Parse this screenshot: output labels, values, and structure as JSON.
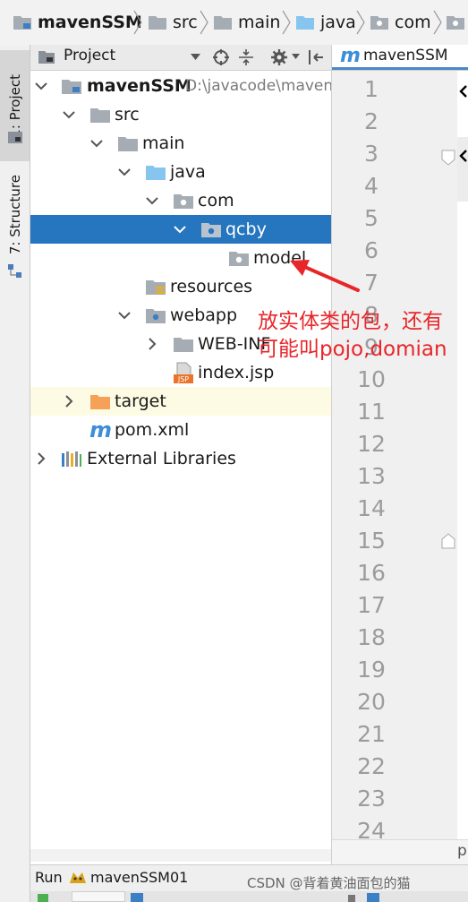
{
  "breadcrumb": {
    "items": [
      {
        "label": "mavenSSM",
        "icon": "module-folder-icon",
        "bold": true
      },
      {
        "label": "src",
        "icon": "folder-icon"
      },
      {
        "label": "main",
        "icon": "folder-icon"
      },
      {
        "label": "java",
        "icon": "source-folder-icon"
      },
      {
        "label": "com",
        "icon": "package-icon"
      }
    ]
  },
  "tool_window_strip": {
    "tabs": [
      {
        "label": "1: Project",
        "active": true
      },
      {
        "label": "7: Structure",
        "active": false
      }
    ]
  },
  "project_panel": {
    "view_selector": "Project",
    "tree": [
      {
        "label": "mavenSSM",
        "path_hint": "D:\\javacode\\maven",
        "icon": "module-folder-icon",
        "expanded": true,
        "bold": true
      },
      {
        "label": "src",
        "icon": "folder-icon",
        "expanded": true
      },
      {
        "label": "main",
        "icon": "folder-icon",
        "expanded": true
      },
      {
        "label": "java",
        "icon": "source-folder-icon",
        "expanded": true
      },
      {
        "label": "com",
        "icon": "package-icon",
        "expanded": true
      },
      {
        "label": "qcby",
        "icon": "package-icon",
        "expanded": true,
        "selected": true
      },
      {
        "label": "model",
        "icon": "package-icon"
      },
      {
        "label": "resources",
        "icon": "resources-folder-icon"
      },
      {
        "label": "webapp",
        "icon": "web-folder-icon",
        "expanded": true
      },
      {
        "label": "WEB-INF",
        "icon": "folder-icon",
        "expanded": false
      },
      {
        "label": "index.jsp",
        "icon": "jsp-file-icon"
      },
      {
        "label": "target",
        "icon": "excluded-folder-icon",
        "expanded": false,
        "highlighted": true
      },
      {
        "label": "pom.xml",
        "icon": "maven-file-icon"
      },
      {
        "label": "External Libraries",
        "icon": "libraries-icon",
        "expanded": false
      }
    ]
  },
  "editor": {
    "tab_label": "mavenSSM",
    "line_numbers": [
      "1",
      "2",
      "3",
      "4",
      "5",
      "6",
      "7",
      "8",
      "9",
      "10",
      "11",
      "12",
      "13",
      "14",
      "15",
      "16",
      "17",
      "18",
      "19",
      "20",
      "21",
      "22",
      "23",
      "24"
    ]
  },
  "annotation": {
    "line1": "放实体类的包，还有",
    "line2": "可能叫pojo,domian",
    "color": "#e8262a"
  },
  "run_bar": {
    "prefix": "Run",
    "config": "mavenSSM01"
  },
  "watermark": "CSDN @背着黄油面包的猫",
  "colors": {
    "selection": "#2675bf",
    "highlight_row": "#fdfbe3",
    "folder_blue": "#86c6ee",
    "folder_gray": "#a6acb3",
    "target_orange": "#f6a158"
  }
}
